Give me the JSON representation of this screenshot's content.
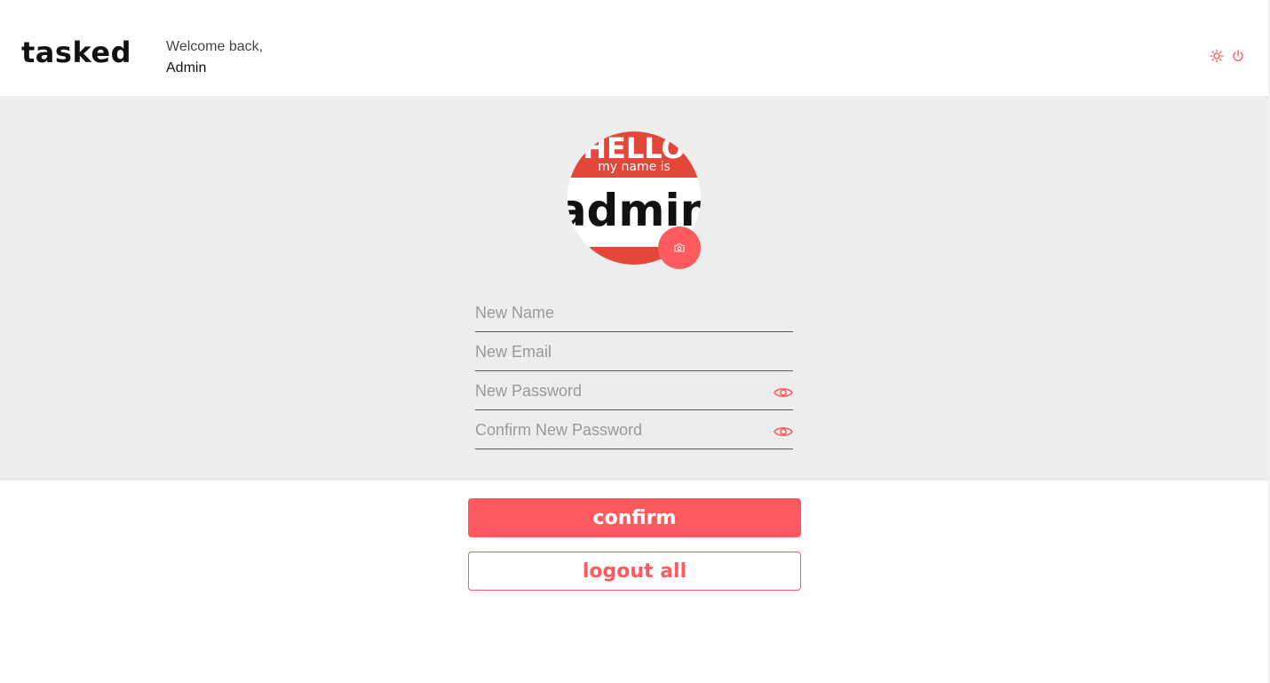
{
  "app": {
    "logo": "tasked"
  },
  "header": {
    "welcome_line": "Welcome back,",
    "user_name": "Admin",
    "icons": [
      "sun-icon",
      "power-icon"
    ]
  },
  "avatar": {
    "badge_top": "HELLO",
    "badge_sub": "my name is",
    "badge_name": "admin",
    "camera_icon": "camera-icon"
  },
  "form": {
    "name_placeholder": "New Name",
    "email_placeholder": "New Email",
    "password_placeholder": "New Password",
    "confirm_placeholder": "Confirm New Password",
    "eye_icon": "eye-icon"
  },
  "actions": {
    "confirm_label": "confirm",
    "logout_all_label": "logout all"
  },
  "colors": {
    "accent": "#ff5a5f",
    "panel_bg": "#ededed",
    "badge_red": "#e2473a"
  }
}
